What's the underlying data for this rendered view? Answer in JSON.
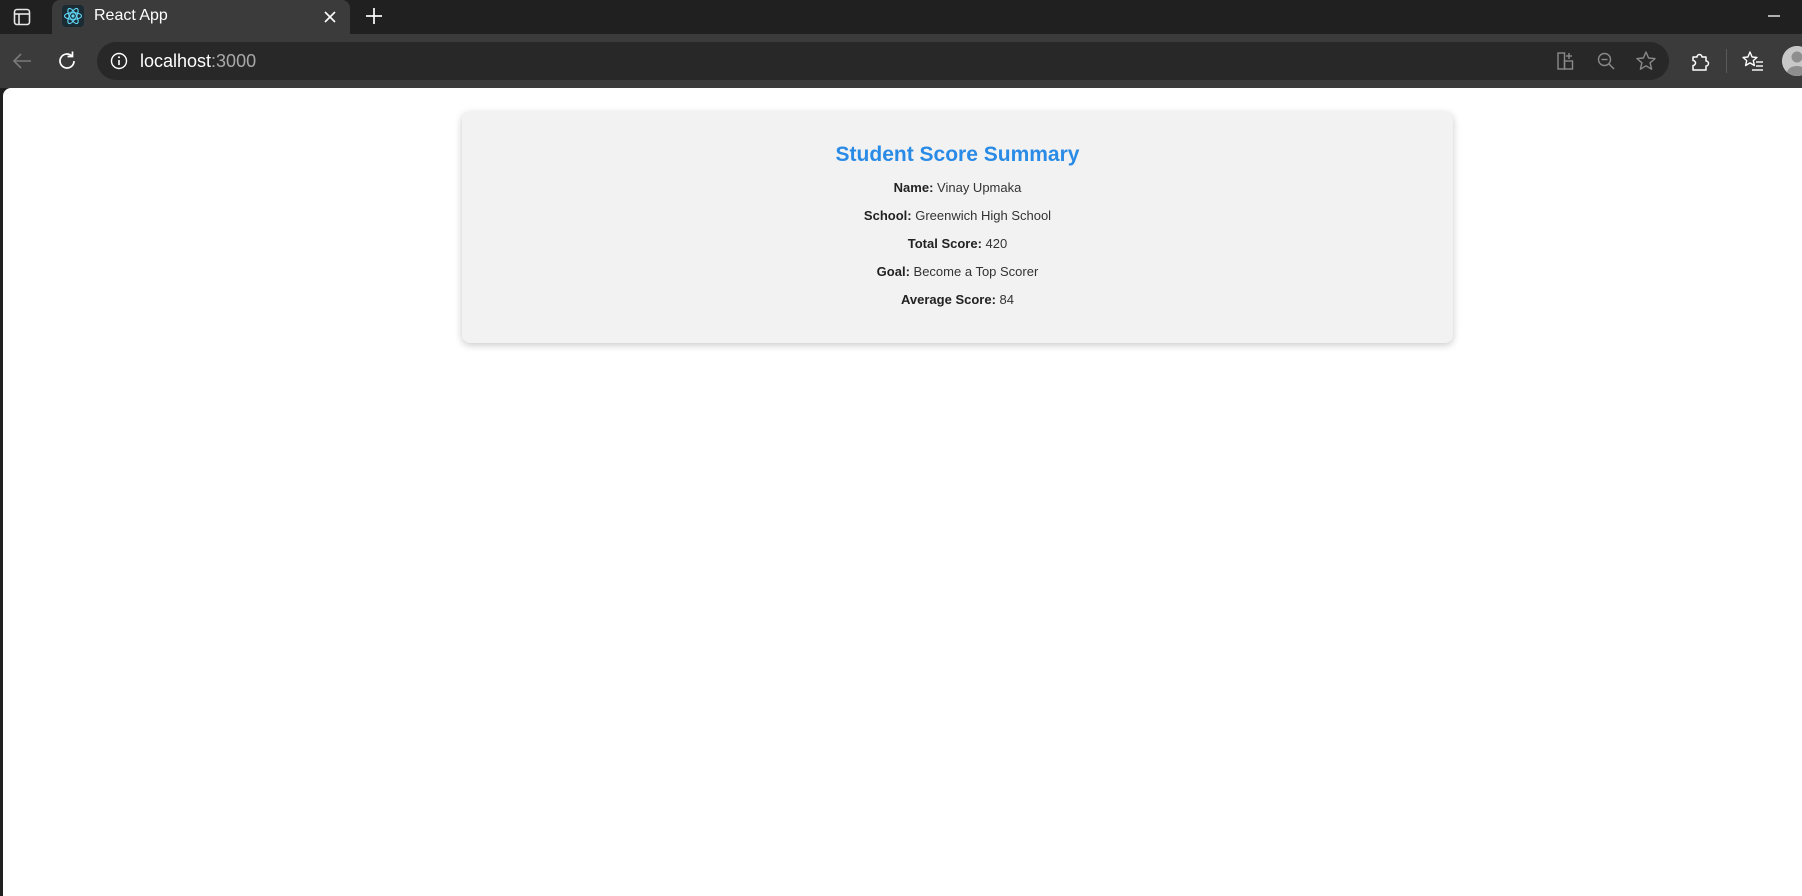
{
  "browser": {
    "tab": {
      "title": "React App"
    },
    "address_bar": {
      "host": "localhost",
      "port": ":3000"
    }
  },
  "card": {
    "title": "Student Score Summary",
    "rows": [
      {
        "label": "Name:",
        "value": "Vinay Upmaka"
      },
      {
        "label": "School:",
        "value": "Greenwich High School"
      },
      {
        "label": "Total Score:",
        "value": "420"
      },
      {
        "label": "Goal:",
        "value": "Become a Top Scorer"
      },
      {
        "label": "Average Score:",
        "value": "84"
      }
    ]
  },
  "colors": {
    "title_accent": "#2a8be6",
    "card_background": "#f2f2f2",
    "browser_chrome": "#202020"
  },
  "icons": [
    "tab-actions-icon",
    "react-favicon-icon",
    "close-icon",
    "plus-icon",
    "minimize-icon",
    "back-arrow-icon",
    "reload-icon",
    "info-icon",
    "app-grid-icon",
    "zoom-out-icon",
    "star-icon",
    "extensions-icon",
    "favorites-icon",
    "profile-avatar-icon"
  ]
}
